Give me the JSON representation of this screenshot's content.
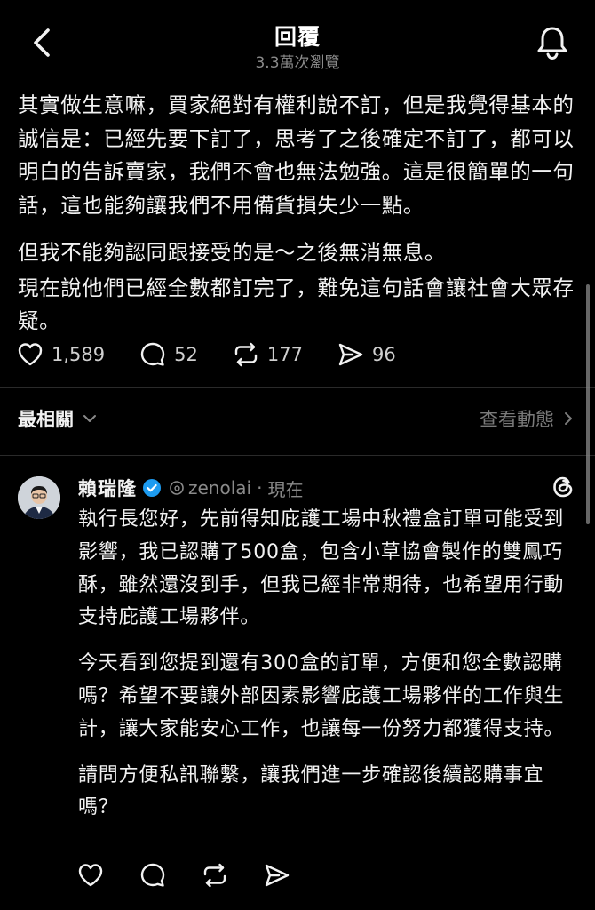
{
  "header": {
    "title": "回覆",
    "subtitle": "3.3萬次瀏覽"
  },
  "post": {
    "paragraphs": [
      "其實做生意嘛，買家絕對有權利說不訂，但是我覺得基本的誠信是：已經先要下訂了，思考了之後確定不訂了，都可以明白的告訴賣家，我們不會也無法勉強。這是很簡單的一句話，這也能夠讓我們不用備貨損失少一點。",
      "但我不能夠認同跟接受的是～之後無消無息。",
      "現在說他們已經全數都訂完了，難免這句話會讓社會大眾存疑。"
    ],
    "actions": {
      "likes": "1,589",
      "comments": "52",
      "reposts": "177",
      "shares": "96"
    }
  },
  "sort": {
    "label": "最相關",
    "activity_label": "查看動態"
  },
  "reply": {
    "name": "賴瑞隆",
    "handle": "zenolai",
    "dot": "·",
    "time": "現在",
    "paragraphs": [
      "執行長您好，先前得知庇護工場中秋禮盒訂單可能受到影響，我已認購了500盒，包含小草協會製作的雙鳳巧酥，雖然還沒到手，但我已經非常期待，也希望用行動支持庇護工場夥伴。",
      "今天看到您提到還有300盒的訂單，方便和您全數認購嗎？希望不要讓外部因素影響庇護工場夥伴的工作與生計，讓大家能安心工作，也讓每一份努力都獲得支持。",
      "請問方便私訊聯繫，讓我們進一步確認後續認購事宜嗎？"
    ]
  },
  "icons": {
    "back": "chevron-left-icon",
    "bell": "bell-icon",
    "like": "heart-icon",
    "comment": "comment-bubble-icon",
    "repost": "repost-icon",
    "share": "send-icon",
    "sort_chevron": "chevron-down-icon",
    "activity_chevron": "chevron-right-icon",
    "verified": "verified-badge-icon",
    "threads": "threads-logo-icon"
  },
  "colors": {
    "background": "#000000",
    "text": "#f2f2f2",
    "muted": "#8a8a8a",
    "verified": "#1d9bf0"
  }
}
